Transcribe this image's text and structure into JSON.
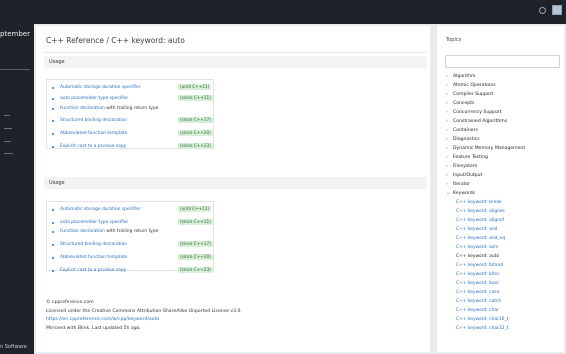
{
  "sidebar": {
    "title": "ptember",
    "footer": "n Software"
  },
  "breadcrumb": {
    "root": "C++ Reference",
    "separator": " / ",
    "current": "C++ keyword: auto"
  },
  "sections": [
    {
      "heading": "Usage",
      "items": [
        {
          "text": "Automatic storage duration specifier",
          "extra": "",
          "badge": "(until C++11)"
        },
        {
          "text": "auto placeholder type specifier",
          "extra": "",
          "badge": "(since C++11)"
        },
        {
          "text": "Function declaration",
          "extra": " with trailing return type",
          "badge": ""
        },
        {
          "text": "Structured binding declaration",
          "extra": "",
          "badge": "(since C++17)"
        },
        {
          "text": "Abbreviated function template",
          "extra": "",
          "badge": "(since C++20)"
        },
        {
          "text": "Explicit cast to a prvalue copy",
          "extra": "",
          "badge": "(since C++23)"
        }
      ]
    },
    {
      "heading": "Usage",
      "items": [
        {
          "text": "Automatic storage duration specifier",
          "extra": "",
          "badge": "(until C++11)"
        },
        {
          "text": "auto placeholder type specifier",
          "extra": "",
          "badge": "(since C++11)"
        },
        {
          "text": "Function declaration",
          "extra": " with trailing return type",
          "badge": ""
        },
        {
          "text": "Structured binding declaration",
          "extra": "",
          "badge": "(since C++17)"
        },
        {
          "text": "Abbreviated function template",
          "extra": "",
          "badge": "(since C++20)"
        },
        {
          "text": "Explicit cast to a prvalue copy",
          "extra": "",
          "badge": "(since C++23)"
        }
      ]
    }
  ],
  "footer": {
    "copyright": "© cppreference.com",
    "license": "Licensed under the Creative Commons Attribution-ShareAlike Unported License v3.0.",
    "url": "https://en.cppreference.com/w/cpp/keyword/auto",
    "mirror": "Mirrored with Blink. Last updated 5h ago."
  },
  "topics": {
    "title": "Topics",
    "search_placeholder": "",
    "items": [
      "Algorithm",
      "Atomic Operations",
      "Compiler Support",
      "Concepts",
      "Concurrency Support",
      "Constrained Algorithms",
      "Containers",
      "Diagnostics",
      "Dynamic Memory Management",
      "Feature Testing",
      "Filesystem",
      "Input/Output",
      "Iterator",
      "Keywords"
    ],
    "keywords": [
      "C++ keyword: break",
      "C++ keyword: alignas",
      "C++ keyword: alignof",
      "C++ keyword: and",
      "C++ keyword: and_eq",
      "C++ keyword: asm",
      "C++ keyword: auto",
      "C++ keyword: bitand",
      "C++ keyword: bitor",
      "C++ keyword: bool",
      "C++ keyword: case",
      "C++ keyword: catch",
      "C++ keyword: char",
      "C++ keyword: char16_t",
      "C++ keyword: char32_t"
    ],
    "active_keyword": "C++ keyword: auto",
    "chevron_collapsed": "›",
    "chevron_expanded": "⌄"
  },
  "colors": {
    "link": "#2a6ebb",
    "badge_bg": "#d7eed7",
    "badge_text": "#276b2d",
    "dark_chrome": "#1f2329"
  }
}
